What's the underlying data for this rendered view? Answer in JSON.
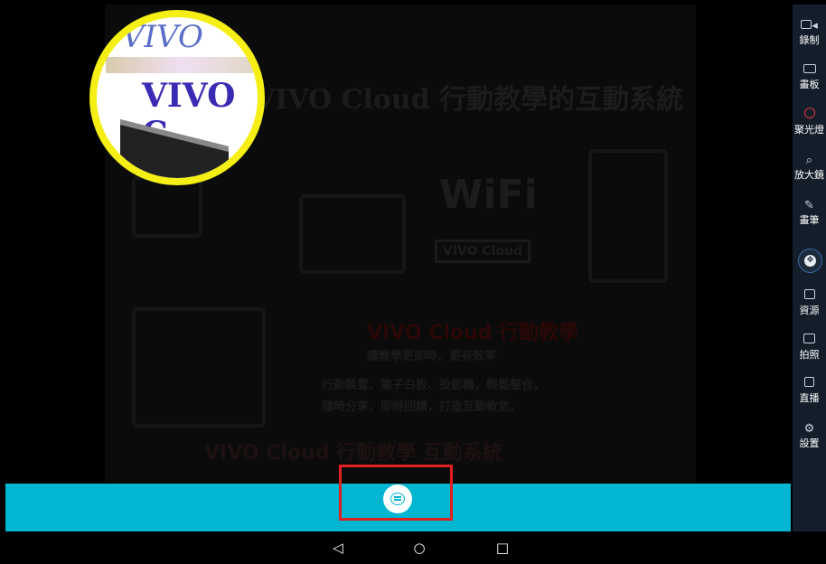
{
  "slide": {
    "title": "VIVO Cloud 行動教學的互動系統",
    "wifi_text": "WiFi",
    "wifi_sub": "VIVO Cloud",
    "center_heading": "VIVO Cloud 行動教學",
    "center_line1": "讓教學更即時、更有效率",
    "center_line2": "行動裝置、電子白板、投影機，輕鬆整合，",
    "center_line3": "隨時分享、即時回饋，打造互動教室。",
    "footer": "VIVO Cloud 行動教學 互動系統"
  },
  "magnifier": {
    "brand_text": "VIVO",
    "title_text": "VIVO C"
  },
  "toolbar": {
    "items": [
      {
        "label": "錄制",
        "icon": "video-camera-icon"
      },
      {
        "label": "畫板",
        "icon": "whiteboard-icon"
      },
      {
        "label": "聚光燈",
        "icon": "spotlight-icon"
      },
      {
        "label": "放大鏡",
        "icon": "magnifier-icon"
      },
      {
        "label": "畫筆",
        "icon": "pen-icon"
      },
      {
        "label": "資源",
        "icon": "folder-icon"
      },
      {
        "label": "拍照",
        "icon": "camera-icon"
      },
      {
        "label": "直播",
        "icon": "live-tv-icon"
      },
      {
        "label": "設置",
        "icon": "gear-icon"
      }
    ],
    "nav_button_icon": "directional-pad-icon"
  },
  "bottom_bar": {
    "chat_icon": "chat-bubble-icon",
    "accent": "#00b6d1",
    "highlight_color": "#e01f1f"
  },
  "android_nav": {
    "back_glyph": "◁",
    "home_glyph": "○",
    "recents_glyph": "□"
  }
}
